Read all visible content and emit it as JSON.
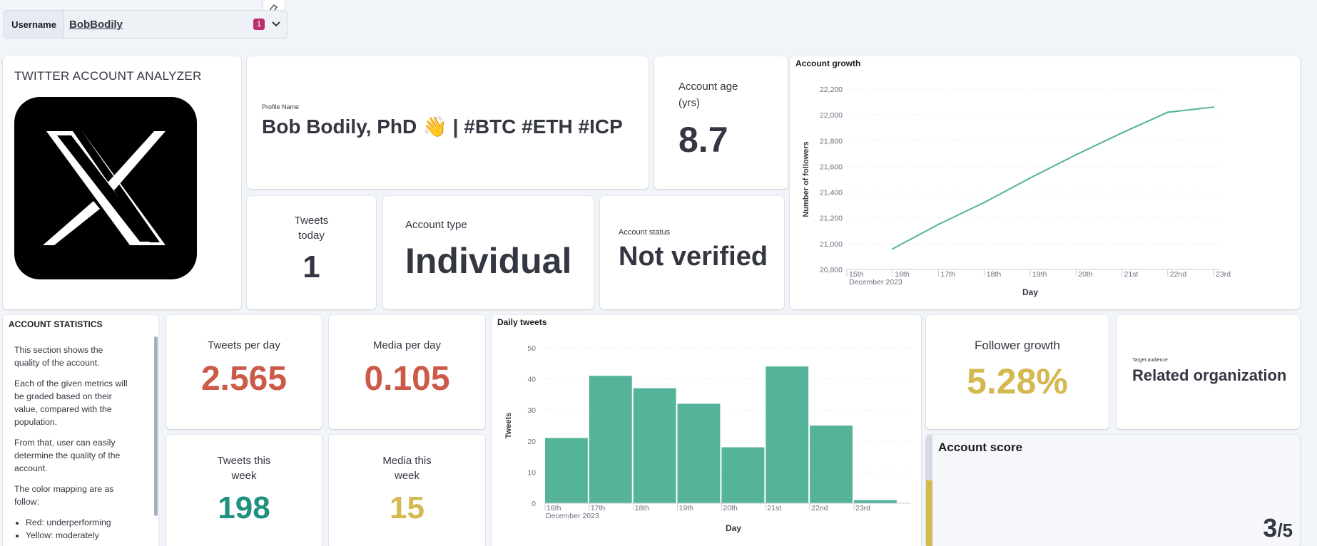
{
  "filter": {
    "label": "Username",
    "value": "BobBodily",
    "badge": "1"
  },
  "header": {
    "title": "TWITTER ACCOUNT ANALYZER"
  },
  "profile": {
    "label": "Profile Name",
    "name": "Bob Bodily, PhD 👋 | #BTC #ETH #ICP"
  },
  "account_age": {
    "label_line1": "Account age",
    "label_line2": "(yrs)",
    "value": "8.7"
  },
  "tweets_today": {
    "label_line1": "Tweets",
    "label_line2": "today",
    "value": "1"
  },
  "account_type": {
    "label": "Account type",
    "value": "Individual"
  },
  "account_status": {
    "label": "Account status",
    "value": "Not verified"
  },
  "stats": {
    "title": "ACCOUNT STATISTICS",
    "p1": "This section shows the quality of the account.",
    "p2": "Each of the given metrics will be graded based on their value, compared with the population.",
    "p3": "From that, user can easily determine the quality of the account.",
    "p4": "The color mapping are as follow:",
    "li1": "Red: underperforming",
    "li2": "Yellow: moderately"
  },
  "tweets_per_day": {
    "label": "Tweets per day",
    "value": "2.565"
  },
  "media_per_day": {
    "label": "Media per day",
    "value": "0.105"
  },
  "tweets_week": {
    "label_line1": "Tweets this",
    "label_line2": "week",
    "value": "198"
  },
  "media_week": {
    "label_line1": "Media this",
    "label_line2": "week",
    "value": "15"
  },
  "follower_growth": {
    "label": "Follower growth",
    "value": "5.28%"
  },
  "target_audience": {
    "label": "Target audience",
    "value": "Related organization"
  },
  "account_score": {
    "title": "Account score",
    "value": "3",
    "max": "/5",
    "fill": 0.6
  },
  "colors": {
    "red": "#cb5b48",
    "yellow": "#d4b850",
    "green": "#21917f",
    "bar": "#54b399",
    "line": "#54b399"
  },
  "chart_data": [
    {
      "type": "line",
      "title": "Account growth",
      "xlabel": "Day",
      "ylabel": "Number of followers",
      "x": [
        "16th",
        "17th",
        "18th",
        "19th",
        "20th",
        "21st",
        "22nd",
        "23rd"
      ],
      "x_ticks": [
        "15th",
        "16th",
        "17th",
        "18th",
        "19th",
        "20th",
        "21st",
        "22nd",
        "23rd"
      ],
      "x_sub": "December 2023",
      "y_ticks": [
        "20,800",
        "21,000",
        "21,200",
        "21,400",
        "21,600",
        "21,800",
        "22,000",
        "22,200"
      ],
      "values": [
        20960,
        21150,
        21320,
        21510,
        21690,
        21860,
        22020,
        22060
      ],
      "ylim": [
        20800,
        22200
      ]
    },
    {
      "type": "bar",
      "title": "Daily tweets",
      "xlabel": "Day",
      "ylabel": "Tweets",
      "categories": [
        "16th",
        "17th",
        "18th",
        "19th",
        "20th",
        "21st",
        "22nd",
        "23rd"
      ],
      "x_sub": "December 2023",
      "y_ticks": [
        "0",
        "10",
        "20",
        "30",
        "40",
        "50"
      ],
      "values": [
        21,
        41,
        37,
        32,
        18,
        44,
        25,
        1
      ],
      "ylim": [
        0,
        50
      ]
    }
  ]
}
